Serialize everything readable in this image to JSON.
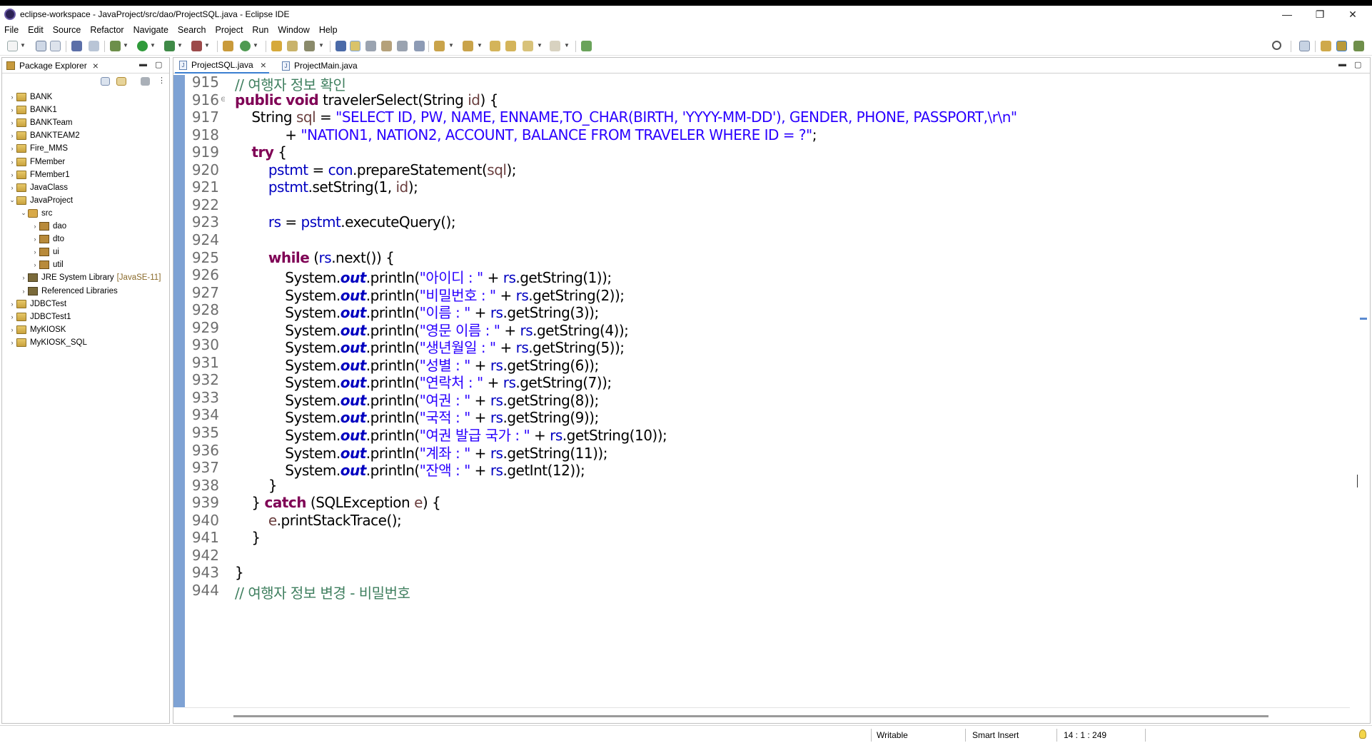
{
  "window": {
    "title": "eclipse-workspace - JavaProject/src/dao/ProjectSQL.java - Eclipse IDE",
    "minimize": "—",
    "maximize": "❐",
    "close": "✕"
  },
  "menu": [
    "File",
    "Edit",
    "Source",
    "Refactor",
    "Navigate",
    "Search",
    "Project",
    "Run",
    "Window",
    "Help"
  ],
  "package_explorer": {
    "title": "Package Explorer",
    "tree": [
      {
        "label": "BANK",
        "expanded": false,
        "icon": "project-icon"
      },
      {
        "label": "BANK1",
        "expanded": false,
        "icon": "project-icon"
      },
      {
        "label": "BANKTeam",
        "expanded": false,
        "icon": "project-icon"
      },
      {
        "label": "BANKTEAM2",
        "expanded": false,
        "icon": "project-icon"
      },
      {
        "label": "Fire_MMS",
        "expanded": false,
        "icon": "project-icon"
      },
      {
        "label": "FMember",
        "expanded": false,
        "icon": "project-icon"
      },
      {
        "label": "FMember1",
        "expanded": false,
        "icon": "project-icon"
      },
      {
        "label": "JavaClass",
        "expanded": false,
        "icon": "project-icon"
      },
      {
        "label": "JavaProject",
        "expanded": true,
        "icon": "project-icon"
      },
      {
        "label": "src",
        "expanded": true,
        "icon": "source-folder-icon"
      },
      {
        "label": "dao",
        "expanded": false,
        "icon": "package-icon"
      },
      {
        "label": "dto",
        "expanded": false,
        "icon": "package-icon"
      },
      {
        "label": "ui",
        "expanded": false,
        "icon": "package-icon"
      },
      {
        "label": "util",
        "expanded": false,
        "icon": "package-icon"
      },
      {
        "label": "JRE System Library",
        "extra": "[JavaSE-11]",
        "expanded": false,
        "icon": "library-icon"
      },
      {
        "label": "Referenced Libraries",
        "expanded": false,
        "icon": "library-icon"
      },
      {
        "label": "JDBCTest",
        "expanded": false,
        "icon": "project-icon"
      },
      {
        "label": "JDBCTest1",
        "expanded": false,
        "icon": "project-icon"
      },
      {
        "label": "MyKIOSK",
        "expanded": false,
        "icon": "project-icon"
      },
      {
        "label": "MyKIOSK_SQL",
        "expanded": false,
        "icon": "project-icon"
      }
    ]
  },
  "editor": {
    "tabs": [
      {
        "label": "ProjectSQL.java",
        "active": true
      },
      {
        "label": "ProjectMain.java",
        "active": false
      }
    ],
    "lines": [
      {
        "n": "915",
        "parts": [
          {
            "t": "// 여행자 정보 확인",
            "c": "cm"
          }
        ]
      },
      {
        "n": "916",
        "fold": "⊖",
        "parts": [
          {
            "t": "public",
            "c": "kw"
          },
          {
            "t": " "
          },
          {
            "t": "void",
            "c": "kw"
          },
          {
            "t": " travelerSelect(String "
          },
          {
            "t": "id",
            "c": "lv"
          },
          {
            "t": ") {"
          }
        ]
      },
      {
        "n": "917",
        "parts": [
          {
            "t": "    String "
          },
          {
            "t": "sql",
            "c": "lv"
          },
          {
            "t": " = "
          },
          {
            "t": "\"SELECT ID, PW, NAME, ENNAME,TO_CHAR(BIRTH, 'YYYY-MM-DD'), GENDER, PHONE, PASSPORT,\\r\\n\"",
            "c": "str"
          }
        ]
      },
      {
        "n": "918",
        "parts": [
          {
            "t": "            + "
          },
          {
            "t": "\"NATION1, NATION2, ACCOUNT, BALANCE FROM TRAVELER WHERE ID = ?\"",
            "c": "str"
          },
          {
            "t": ";"
          }
        ]
      },
      {
        "n": "919",
        "parts": [
          {
            "t": "    "
          },
          {
            "t": "try",
            "c": "kw"
          },
          {
            "t": " {"
          }
        ]
      },
      {
        "n": "920",
        "parts": [
          {
            "t": "        "
          },
          {
            "t": "pstmt",
            "c": "fld"
          },
          {
            "t": " = "
          },
          {
            "t": "con",
            "c": "fld"
          },
          {
            "t": ".prepareStatement("
          },
          {
            "t": "sql",
            "c": "lv"
          },
          {
            "t": ");"
          }
        ]
      },
      {
        "n": "921",
        "parts": [
          {
            "t": "        "
          },
          {
            "t": "pstmt",
            "c": "fld"
          },
          {
            "t": ".setString(1, "
          },
          {
            "t": "id",
            "c": "lv"
          },
          {
            "t": ");"
          }
        ]
      },
      {
        "n": "922",
        "parts": [
          {
            "t": ""
          }
        ]
      },
      {
        "n": "923",
        "parts": [
          {
            "t": "        "
          },
          {
            "t": "rs",
            "c": "fld"
          },
          {
            "t": " = "
          },
          {
            "t": "pstmt",
            "c": "fld"
          },
          {
            "t": ".executeQuery();"
          }
        ]
      },
      {
        "n": "924",
        "parts": [
          {
            "t": ""
          }
        ]
      },
      {
        "n": "925",
        "parts": [
          {
            "t": "        "
          },
          {
            "t": "while",
            "c": "kw"
          },
          {
            "t": " ("
          },
          {
            "t": "rs",
            "c": "fld"
          },
          {
            "t": ".next()) {"
          }
        ]
      },
      {
        "n": "926",
        "parts": [
          {
            "t": "            System."
          },
          {
            "t": "out",
            "c": "sfld"
          },
          {
            "t": ".println("
          },
          {
            "t": "\"아이디 : \"",
            "c": "str"
          },
          {
            "t": " + "
          },
          {
            "t": "rs",
            "c": "fld"
          },
          {
            "t": ".getString(1));"
          }
        ]
      },
      {
        "n": "927",
        "parts": [
          {
            "t": "            System."
          },
          {
            "t": "out",
            "c": "sfld"
          },
          {
            "t": ".println("
          },
          {
            "t": "\"비밀번호 : \"",
            "c": "str"
          },
          {
            "t": " + "
          },
          {
            "t": "rs",
            "c": "fld"
          },
          {
            "t": ".getString(2));"
          }
        ]
      },
      {
        "n": "928",
        "parts": [
          {
            "t": "            System."
          },
          {
            "t": "out",
            "c": "sfld"
          },
          {
            "t": ".println("
          },
          {
            "t": "\"이름 : \"",
            "c": "str"
          },
          {
            "t": " + "
          },
          {
            "t": "rs",
            "c": "fld"
          },
          {
            "t": ".getString(3));"
          }
        ]
      },
      {
        "n": "929",
        "parts": [
          {
            "t": "            System."
          },
          {
            "t": "out",
            "c": "sfld"
          },
          {
            "t": ".println("
          },
          {
            "t": "\"영문 이름 : \"",
            "c": "str"
          },
          {
            "t": " + "
          },
          {
            "t": "rs",
            "c": "fld"
          },
          {
            "t": ".getString(4));"
          }
        ]
      },
      {
        "n": "930",
        "parts": [
          {
            "t": "            System."
          },
          {
            "t": "out",
            "c": "sfld"
          },
          {
            "t": ".println("
          },
          {
            "t": "\"생년월일 : \"",
            "c": "str"
          },
          {
            "t": " + "
          },
          {
            "t": "rs",
            "c": "fld"
          },
          {
            "t": ".getString(5));"
          }
        ]
      },
      {
        "n": "931",
        "parts": [
          {
            "t": "            System."
          },
          {
            "t": "out",
            "c": "sfld"
          },
          {
            "t": ".println("
          },
          {
            "t": "\"성별 : \"",
            "c": "str"
          },
          {
            "t": " + "
          },
          {
            "t": "rs",
            "c": "fld"
          },
          {
            "t": ".getString(6));"
          }
        ]
      },
      {
        "n": "932",
        "parts": [
          {
            "t": "            System."
          },
          {
            "t": "out",
            "c": "sfld"
          },
          {
            "t": ".println("
          },
          {
            "t": "\"연락처 : \"",
            "c": "str"
          },
          {
            "t": " + "
          },
          {
            "t": "rs",
            "c": "fld"
          },
          {
            "t": ".getString(7));"
          }
        ]
      },
      {
        "n": "933",
        "parts": [
          {
            "t": "            System."
          },
          {
            "t": "out",
            "c": "sfld"
          },
          {
            "t": ".println("
          },
          {
            "t": "\"여권 : \"",
            "c": "str"
          },
          {
            "t": " + "
          },
          {
            "t": "rs",
            "c": "fld"
          },
          {
            "t": ".getString(8));"
          }
        ]
      },
      {
        "n": "934",
        "parts": [
          {
            "t": "            System."
          },
          {
            "t": "out",
            "c": "sfld"
          },
          {
            "t": ".println("
          },
          {
            "t": "\"국적 : \"",
            "c": "str"
          },
          {
            "t": " + "
          },
          {
            "t": "rs",
            "c": "fld"
          },
          {
            "t": ".getString(9));"
          }
        ]
      },
      {
        "n": "935",
        "parts": [
          {
            "t": "            System."
          },
          {
            "t": "out",
            "c": "sfld"
          },
          {
            "t": ".println("
          },
          {
            "t": "\"여권 발급 국가 : \"",
            "c": "str"
          },
          {
            "t": " + "
          },
          {
            "t": "rs",
            "c": "fld"
          },
          {
            "t": ".getString(10));"
          }
        ]
      },
      {
        "n": "936",
        "parts": [
          {
            "t": "            System."
          },
          {
            "t": "out",
            "c": "sfld"
          },
          {
            "t": ".println("
          },
          {
            "t": "\"계좌 : \"",
            "c": "str"
          },
          {
            "t": " + "
          },
          {
            "t": "rs",
            "c": "fld"
          },
          {
            "t": ".getString(11));"
          }
        ]
      },
      {
        "n": "937",
        "parts": [
          {
            "t": "            System."
          },
          {
            "t": "out",
            "c": "sfld"
          },
          {
            "t": ".println("
          },
          {
            "t": "\"잔액 : \"",
            "c": "str"
          },
          {
            "t": " + "
          },
          {
            "t": "rs",
            "c": "fld"
          },
          {
            "t": ".getInt(12));"
          }
        ]
      },
      {
        "n": "938",
        "parts": [
          {
            "t": "        }"
          }
        ]
      },
      {
        "n": "939",
        "parts": [
          {
            "t": "    } "
          },
          {
            "t": "catch",
            "c": "kw"
          },
          {
            "t": " (SQLException "
          },
          {
            "t": "e",
            "c": "lv"
          },
          {
            "t": ") {"
          }
        ]
      },
      {
        "n": "940",
        "parts": [
          {
            "t": "        "
          },
          {
            "t": "e",
            "c": "lv"
          },
          {
            "t": ".printStackTrace();"
          }
        ]
      },
      {
        "n": "941",
        "parts": [
          {
            "t": "    }"
          }
        ]
      },
      {
        "n": "942",
        "parts": [
          {
            "t": ""
          }
        ]
      },
      {
        "n": "943",
        "parts": [
          {
            "t": "}"
          }
        ]
      },
      {
        "n": "944",
        "parts": [
          {
            "t": "// 여행자 정보 변경 - 비밀번호",
            "c": "cm"
          }
        ]
      }
    ]
  },
  "statusbar": {
    "writable": "Writable",
    "insert_mode": "Smart Insert",
    "position": "14 : 1 : 249"
  },
  "colors": {
    "keyword": "#7f0055",
    "string": "#2a00ff",
    "comment": "#3f7f5f",
    "field": "#0000c0",
    "local_var": "#6a3e3e",
    "ruler": "#7ea2d4"
  }
}
